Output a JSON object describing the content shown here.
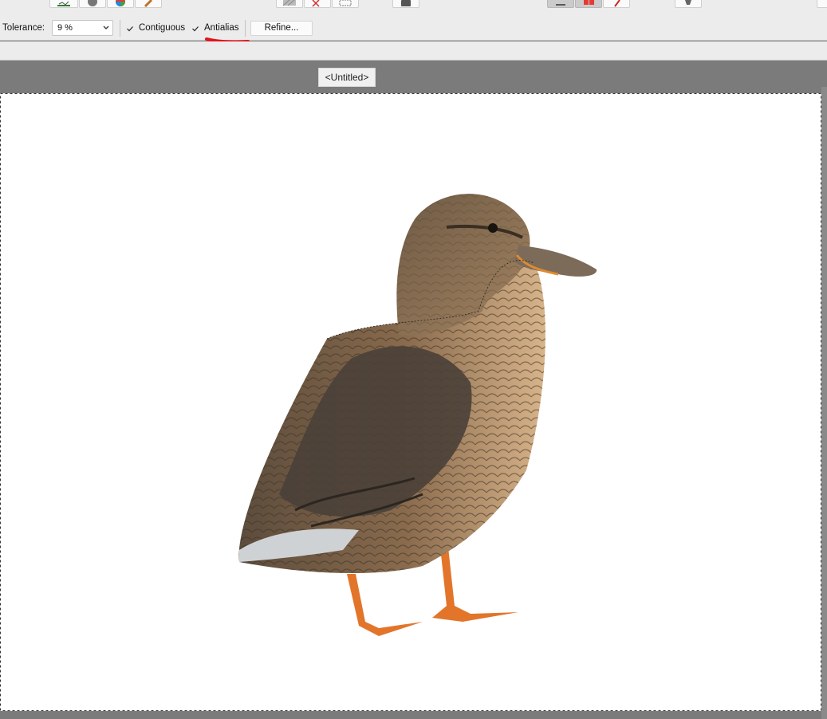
{
  "context_toolbar": {
    "tolerance_label": "Tolerance:",
    "tolerance_value": "9 %",
    "contiguous_label": "Contiguous",
    "contiguous_checked": true,
    "antialias_label": "Antialias",
    "antialias_checked": true,
    "refine_label": "Refine..."
  },
  "document": {
    "tab_title": "<Untitled>"
  },
  "annotation": {
    "color": "#e3121b"
  }
}
